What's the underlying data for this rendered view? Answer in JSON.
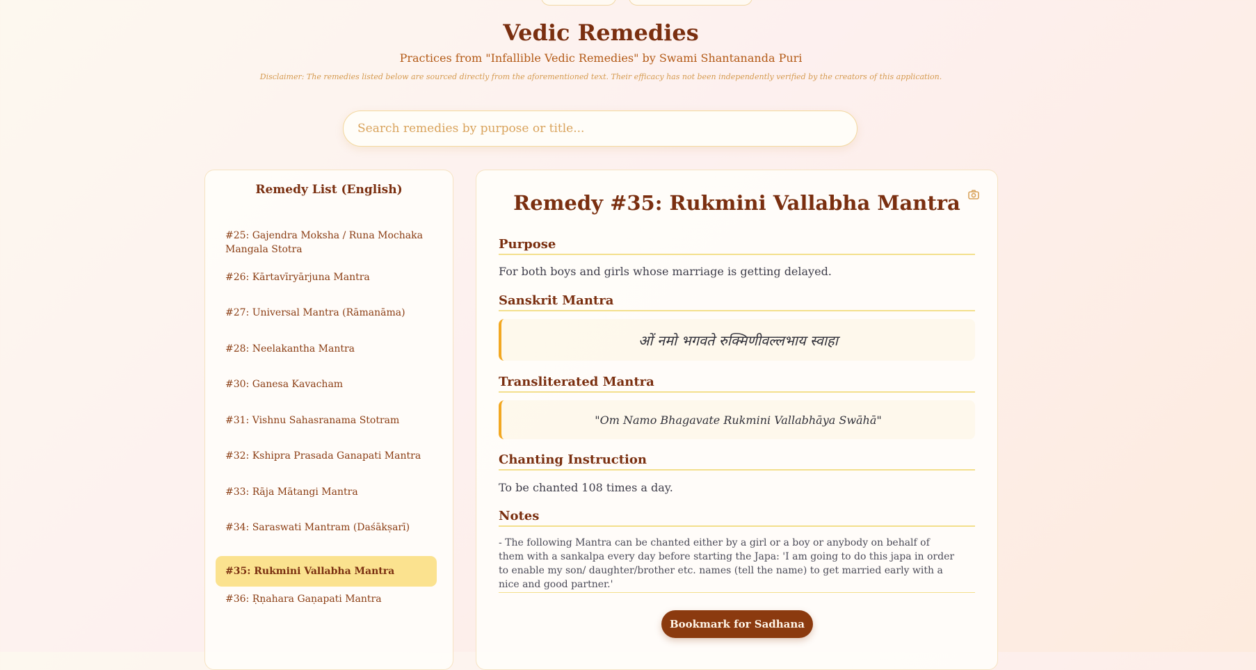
{
  "header": {
    "title": "Vedic Remedies",
    "subtitle": "Practices from \"Infallible Vedic Remedies\" by Swami Shantananda Puri",
    "disclaimer": "Disclaimer: The remedies listed below are sourced directly from the aforementioned text. Their efficacy has not been independently verified by the creators of this application."
  },
  "search": {
    "placeholder": "Search remedies by purpose or title...",
    "value": ""
  },
  "sidebar": {
    "title": "Remedy List (English)",
    "items": [
      {
        "label": "#25: Gajendra Moksha / Runa Mochaka Mangala Stotra",
        "active": false
      },
      {
        "label": "#26: Kārtavīryārjuna Mantra",
        "active": false
      },
      {
        "label": "#27: Universal Mantra (Rāmanāma)",
        "active": false
      },
      {
        "label": "#28: Neelakantha Mantra",
        "active": false
      },
      {
        "label": "#30: Ganesa Kavacham",
        "active": false
      },
      {
        "label": "#31: Vishnu Sahasranama Stotram",
        "active": false
      },
      {
        "label": "#32: Kshipra Prasada Ganapati Mantra",
        "active": false
      },
      {
        "label": "#33: Rāja Mātangi Mantra",
        "active": false
      },
      {
        "label": "#34: Saraswati Mantram (Daśākṣarī)",
        "active": false
      },
      {
        "label": "#35: Rukmini Vallabha Mantra",
        "active": true
      },
      {
        "label": "#36: Ṛṇahara Gaṇapati Mantra",
        "active": false
      }
    ]
  },
  "detail": {
    "title": "Remedy #35: Rukmini Vallabha Mantra",
    "camera_icon": "camera-icon",
    "purpose_heading": "Purpose",
    "purpose": "For both boys and girls whose marriage is getting delayed.",
    "sanskrit_heading": "Sanskrit Mantra",
    "sanskrit": "ओं नमो भगवते रुक्मिणीवल्लभाय स्वाहा",
    "translit_heading": "Transliterated Mantra",
    "translit": "\"Om Namo Bhagavate Rukmini Vallabhāya Swāhā\"",
    "chanting_heading": "Chanting Instruction",
    "chanting": "To be chanted 108 times a day.",
    "notes_heading": "Notes",
    "notes": "- The following Mantra can be chanted either by a girl or a boy or anybody on behalf of them with a sankalpa every day before starting the Japa: 'I am going to do this japa in order to enable my son/ daughter/brother etc. names (tell the name) to get married early with a nice and good partner.'",
    "bookmark_label": "Bookmark for Sadhana"
  },
  "colors": {
    "accent": "#8b3a0f",
    "highlight": "#fbe28f",
    "rule": "#f3df8c",
    "quote_border": "#f2a822"
  }
}
